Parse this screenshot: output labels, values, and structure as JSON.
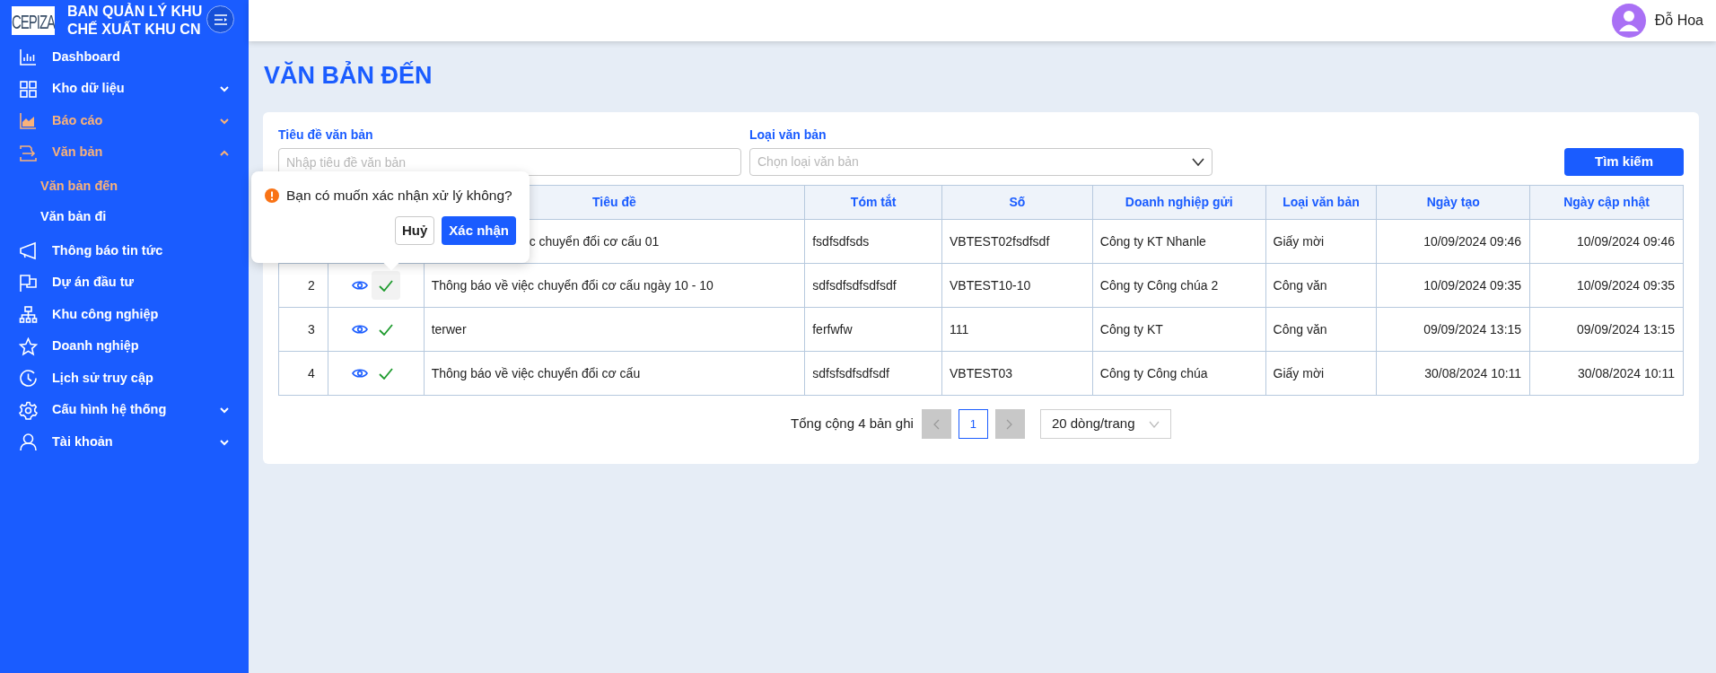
{
  "sidebar": {
    "logo": "CEPIZA",
    "title_lines": [
      "BAN QUẢN LÝ KHU",
      "CHẾ XUẤT KHU CN"
    ],
    "items": [
      {
        "label": "Dashboard",
        "kind": "link",
        "active": false
      },
      {
        "label": "Kho dữ liệu",
        "kind": "group",
        "active": false,
        "expanded": false
      },
      {
        "label": "Báo cáo",
        "kind": "group",
        "active": true,
        "expanded": false
      },
      {
        "label": "Văn bản",
        "kind": "group",
        "active": true,
        "expanded": true,
        "children": [
          {
            "label": "Văn bản đến",
            "selected": true
          },
          {
            "label": "Văn bản đi",
            "selected": false
          }
        ]
      },
      {
        "label": "Thông báo tin tức",
        "kind": "link",
        "active": false
      },
      {
        "label": "Dự án đầu tư",
        "kind": "link",
        "active": false
      },
      {
        "label": "Khu công nghiệp",
        "kind": "link",
        "active": false
      },
      {
        "label": "Doanh nghiệp",
        "kind": "link",
        "active": false
      },
      {
        "label": "Lịch sử truy cập",
        "kind": "link",
        "active": false
      },
      {
        "label": "Cấu hình hệ thống",
        "kind": "group",
        "active": false,
        "expanded": false
      },
      {
        "label": "Tài khoản",
        "kind": "group",
        "active": false,
        "expanded": false
      }
    ]
  },
  "header": {
    "user_name": "Đỗ Hoa"
  },
  "page_title": "VĂN BẢN ĐẾN",
  "filters": [
    {
      "kind": "text",
      "label": "Tiêu đề văn bản",
      "placeholder": "Nhập tiêu đề văn bản"
    },
    {
      "kind": "select",
      "label": "Loại văn bản",
      "placeholder": "Chọn loại văn bản"
    }
  ],
  "search_button": "Tìm kiếm",
  "table": {
    "columns": [
      "Tiêu đề",
      "Tóm tắt",
      "Số",
      "Doanh nghiệp gửi",
      "Loại văn bản",
      "Ngày tạo",
      "Ngày cập nhật"
    ],
    "rows": [
      {
        "title": "c chuyển đổi cơ cấu 01",
        "summary": "fsdfsdfsds",
        "number_code": "VBTEST02fsdfsdf",
        "company": "Công ty KT Nhanle",
        "doc_type": "Giấy mời",
        "created": "10/09/2024 09:46",
        "updated": "10/09/2024 09:46"
      },
      {
        "index": "2",
        "action_hovered": true,
        "title": "Thông báo về việc chuyển đổi cơ cấu ngày 10 - 10",
        "summary": "sdfsdfsdfsdfsdf",
        "number_code": "VBTEST10-10",
        "company": "Công ty Công chúa 2",
        "doc_type": "Công văn",
        "created": "10/09/2024 09:35",
        "updated": "10/09/2024 09:35"
      },
      {
        "index": "3",
        "action_hovered": false,
        "title": "terwer",
        "summary": "ferfwfw",
        "number_code": "111",
        "company": "Công ty KT",
        "doc_type": "Công văn",
        "created": "09/09/2024 13:15",
        "updated": "09/09/2024 13:15"
      },
      {
        "index": "4",
        "action_hovered": false,
        "title": "Thông báo về việc chuyển đổi cơ cấu",
        "summary": "sdfsfsdfsdfsdf",
        "number_code": "VBTEST03",
        "company": "Công ty Công chúa",
        "doc_type": "Giấy mời",
        "created": "30/08/2024 10:11",
        "updated": "30/08/2024 10:11"
      }
    ]
  },
  "popover": {
    "message": "Bạn có muốn xác nhận xử lý không?",
    "cancel": "Huỷ",
    "confirm": "Xác nhận"
  },
  "pagination": {
    "total": "Tổng cộng 4 bản ghi",
    "prev_disabled": true,
    "next_disabled": true,
    "pages": [
      {
        "label": "1",
        "selected": true
      }
    ],
    "page_size": "20 dòng/trang"
  }
}
